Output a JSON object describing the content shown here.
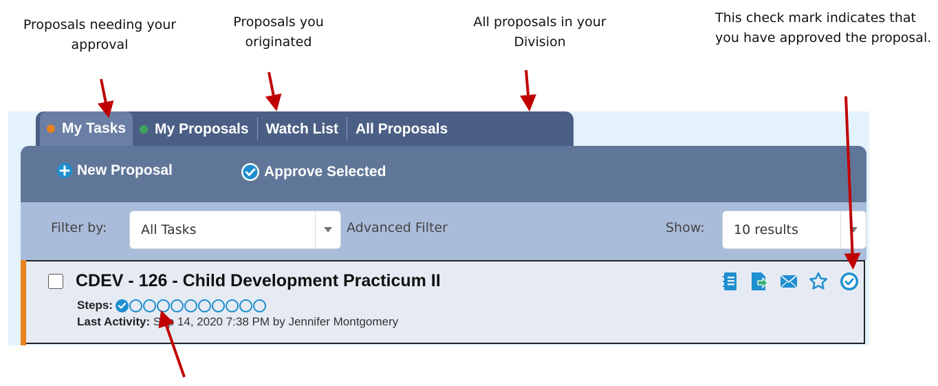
{
  "callouts": {
    "tasks": "Proposals needing your approval",
    "proposals": "Proposals you originated",
    "all": "All proposals in your Division",
    "check": "This check mark indicates that you have approved the proposal."
  },
  "tabs": [
    {
      "label": "My Tasks",
      "dot_color": "#e8821e",
      "active": true
    },
    {
      "label": "My Proposals",
      "dot_color": "#3fa35b",
      "active": false
    },
    {
      "label": "Watch List",
      "active": false
    },
    {
      "label": "All Proposals",
      "active": false
    }
  ],
  "toolbar": {
    "new_label": "New Proposal",
    "approve_label": "Approve Selected"
  },
  "filter": {
    "label": "Filter by:",
    "selected": "All Tasks",
    "advanced": "Advanced Filter",
    "show_label": "Show:",
    "show_selected": "10 results"
  },
  "proposal": {
    "title": "CDEV - 126 - Child Development Practicum II",
    "steps_label": "Steps:",
    "steps_total": 11,
    "steps_completed": 1,
    "last_activity_label": "Last Activity:",
    "last_activity_value": "Sep 14, 2020 7:38 PM by Jennifer Montgomery"
  },
  "colors": {
    "accent_blue": "#1e8fd0",
    "arrow_red": "#c00000",
    "tab_bar": "#4b5f85",
    "toolbar": "#607699",
    "filter_bar": "#a9bcd9"
  }
}
